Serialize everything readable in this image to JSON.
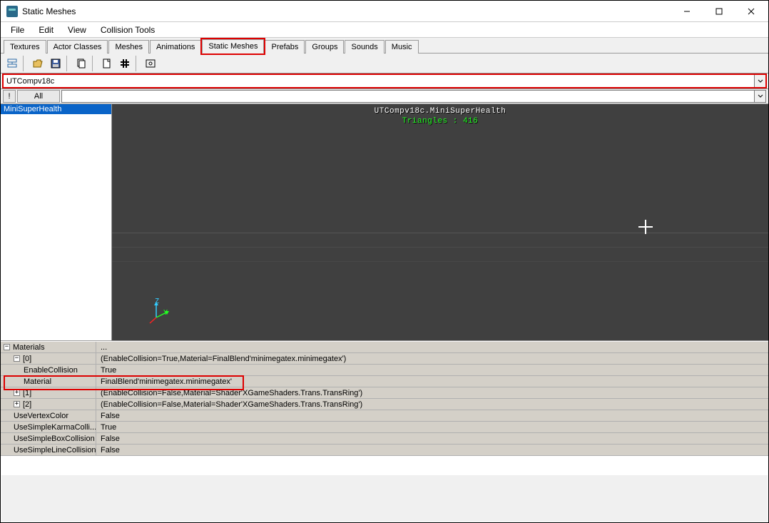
{
  "window": {
    "title": "Static Meshes"
  },
  "menu": {
    "items": [
      "File",
      "Edit",
      "View",
      "Collision Tools"
    ]
  },
  "tabs": {
    "items": [
      "Textures",
      "Actor Classes",
      "Meshes",
      "Animations",
      "Static Meshes",
      "Prefabs",
      "Groups",
      "Sounds",
      "Music"
    ],
    "active": "Static Meshes",
    "highlighted": "Static Meshes"
  },
  "package_combo": {
    "value": "UTCompv18c",
    "highlighted": true
  },
  "filter": {
    "excl_label": "!",
    "all_label": "All"
  },
  "mesh_list": {
    "items": [
      "MiniSuperHealth"
    ],
    "selected": "MiniSuperHealth"
  },
  "viewport": {
    "path_line": "UTCompv18c.MiniSuperHealth",
    "tri_line": "Triangles : 416",
    "axis_z": "Z",
    "axis_y": "Y"
  },
  "props": {
    "header_name": "Materials",
    "header_val": "...",
    "idx0": {
      "label": "[0]",
      "val": "(EnableCollision=True,Material=FinalBlend'minimegatex.minimegatex')",
      "enable_label": "EnableCollision",
      "enable_val": "True",
      "mat_label": "Material",
      "mat_val": "FinalBlend'minimegatex.minimegatex'"
    },
    "idx1": {
      "label": "[1]",
      "val": "(EnableCollision=False,Material=Shader'XGameShaders.Trans.TransRing')"
    },
    "idx2": {
      "label": "[2]",
      "val": "(EnableCollision=False,Material=Shader'XGameShaders.Trans.TransRing')"
    },
    "usevc": {
      "label": "UseVertexColor",
      "val": "False"
    },
    "uskc": {
      "label": "UseSimpleKarmaColli...",
      "val": "True"
    },
    "usbc": {
      "label": "UseSimpleBoxCollision",
      "val": "False"
    },
    "uslc": {
      "label": "UseSimpleLineCollision",
      "val": "False"
    }
  }
}
